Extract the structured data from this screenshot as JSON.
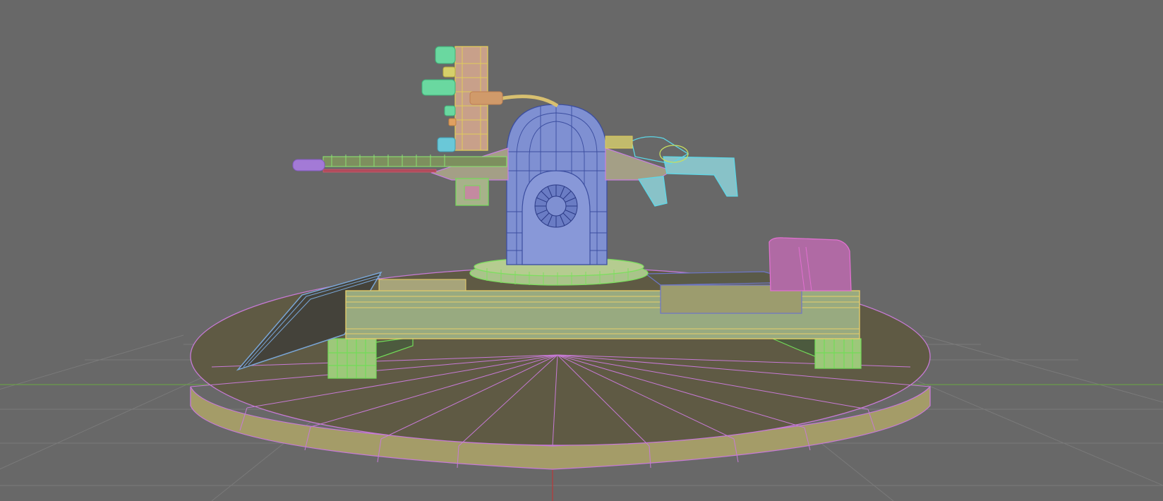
{
  "viewport": {
    "background": "#686868",
    "grid_color": "#7c7c7c",
    "axis_x_color": "#6aa04a",
    "axis_y_color": "#b83a3a"
  },
  "model": {
    "parts": [
      {
        "name": "base-disc",
        "fill": "#9b9464",
        "wire": "#c77ad6"
      },
      {
        "name": "platform",
        "fill": "#98aa80",
        "wire": "#e8cf6a"
      },
      {
        "name": "side-ramp",
        "fill": "#4a4838",
        "wire": "#7aa6d6"
      },
      {
        "name": "rear-box",
        "fill": "#9c9c6e",
        "wire": "#6d76c7"
      },
      {
        "name": "pink-cap",
        "fill": "#b86aa8",
        "wire": "#e070d0"
      },
      {
        "name": "turret-dome",
        "fill": "#7f90d2",
        "wire": "#3c4ea0"
      },
      {
        "name": "turret-ring",
        "fill": "#9bc28a",
        "wire": "#7ede60"
      },
      {
        "name": "gun-deck",
        "fill": "#a49f86",
        "wire": "#c880e0"
      },
      {
        "name": "rifle-barrel",
        "fill": "#7d8f5e",
        "wire": "#8ae070"
      },
      {
        "name": "rifle-stock",
        "fill": "#88c2c8",
        "wire": "#5cd8e8"
      },
      {
        "name": "ammo-tower",
        "fill": "#c8a08a",
        "wire": "#e0cc5a"
      },
      {
        "name": "knobs",
        "fill": "#6ad8a0",
        "wire": "#3fb078"
      },
      {
        "name": "muzzle",
        "fill": "#a37ad6",
        "wire": "#8258c0"
      },
      {
        "name": "foot-blocks",
        "fill": "#9dc87a",
        "wire": "#72dc58"
      }
    ]
  }
}
